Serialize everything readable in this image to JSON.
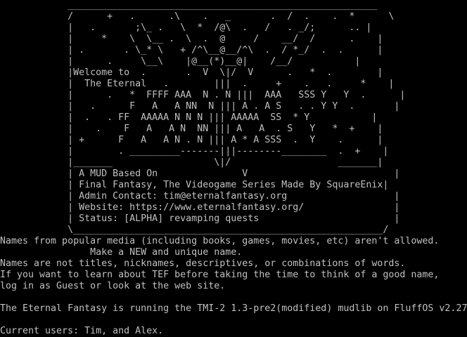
{
  "terminal": {
    "background": "#000000",
    "foreground": "#c0c0c0",
    "lines": [
      "            _______________________________________________________",
      "            /      +   .      .\\    .   _       .  /  .    .  *      \\",
      "            |   .       ;\\_ .   \\  *  /@\\  .   /   . _/;      .. |",
      "            |     *    \\  \\__ .  \\  .  @     /    __/  /      .    |",
      "            | .       . \\_* \\   + /^\\__@__/^\\  .  / *_/  .  .      |",
      "            |      .     \\__\\    |@__(*)__@|    /__/           |",
      "            |Welcome to  .       .  V  \\|/  V      .   *  .        |",
      "            |  The Eternal   .        |||  .     +    .   .     *    |",
      "            |      .   *  FFFF AAA  N . N |||  AAA   SSS Y   Y  .      |",
      "            |   .      F   A   A NN  N ||| A . A S   . . Y Y  .       |",
      "            |  .   . FF  AAAAA N N N ||| AAAAA  SS  * Y           |",
      "            |    .    F   A   A N  NN ||| A   A  . S   Y   *  +    |",
      "            | +      F   A   A N . N ||| A * A SSS  .  Y    .      |",
      "            |        . _________-------|||--------________  .  +    |",
      "            |_______                  \\|/                   _______|",
      "            | A MUD Based On               V                          |",
      "            | Final Fantasy, The Videogame Series Made By SquareEnix|",
      "            | Admin Contact: tim@eternalfantasy.org                   |",
      "            | Website: https://www.eternalfantasy.org/                |",
      "            | Status: [ALPHA] revamping quests                        |",
      "            \\_______________________________________________________/",
      "Names from popular media (including books, games, movies, etc) aren't allowed.",
      "                Make a NEW and unique name.",
      "Names are not titles, nicknames, descriptives, or combinations of words.",
      "If you want to learn about TEF before taking the time to think of a good name,",
      "log in as Guest or look at the web site.",
      "",
      "The Eternal Fantasy is running the TMI-2 1.3-pre2(modified) mudlib on FluffOS v2.27",
      "",
      "Current users: Tim, and Alex."
    ]
  }
}
